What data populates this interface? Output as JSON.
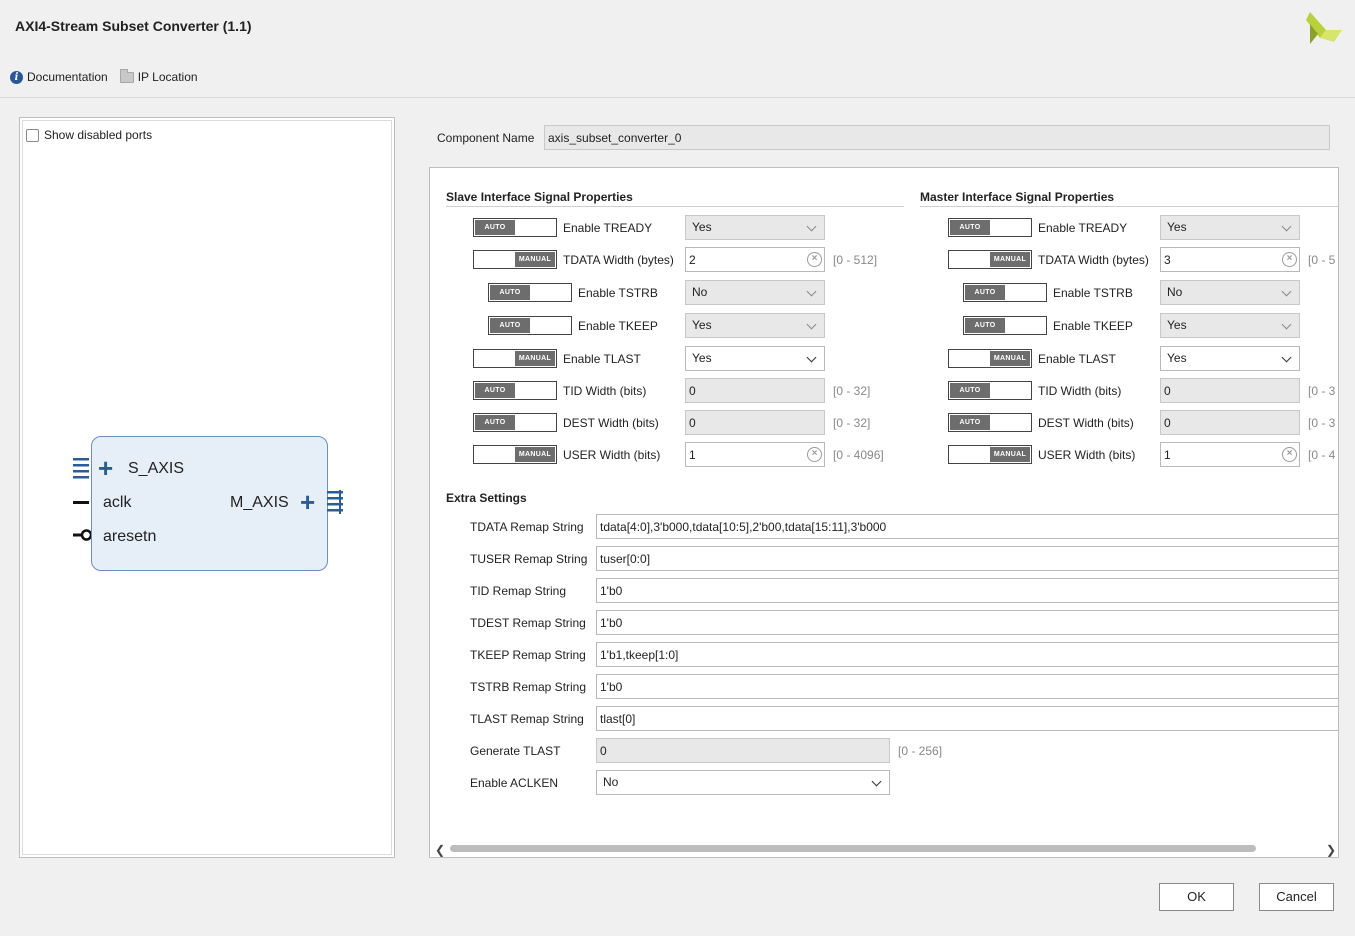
{
  "window": {
    "title": "AXI4-Stream Subset Converter (1.1)"
  },
  "links": {
    "documentation": "Documentation",
    "ip_location": "IP Location"
  },
  "left": {
    "show_disabled": "Show disabled ports",
    "block": {
      "s_axis": "S_AXIS",
      "aclk": "aclk",
      "aresetn": "aresetn",
      "m_axis": "M_AXIS"
    }
  },
  "component": {
    "label": "Component Name",
    "value": "axis_subset_converter_0"
  },
  "slave": {
    "title": "Slave Interface Signal Properties",
    "rows": [
      {
        "mode": "AUTO",
        "label": "Enable TREADY",
        "value": "Yes",
        "range": ""
      },
      {
        "mode": "MANUAL",
        "label": "TDATA Width (bytes)",
        "value": "2",
        "range": "[0 - 512]"
      },
      {
        "mode": "AUTO",
        "label": "Enable TSTRB",
        "value": "No",
        "range": ""
      },
      {
        "mode": "AUTO",
        "label": "Enable TKEEP",
        "value": "Yes",
        "range": ""
      },
      {
        "mode": "MANUAL",
        "label": "Enable TLAST",
        "value": "Yes",
        "range": ""
      },
      {
        "mode": "AUTO",
        "label": "TID Width (bits)",
        "value": "0",
        "range": "[0 - 32]"
      },
      {
        "mode": "AUTO",
        "label": "DEST Width (bits)",
        "value": "0",
        "range": "[0 - 32]"
      },
      {
        "mode": "MANUAL",
        "label": "USER Width (bits)",
        "value": "1",
        "range": "[0 - 4096]"
      }
    ]
  },
  "master": {
    "title": "Master Interface Signal Properties",
    "rows": [
      {
        "mode": "AUTO",
        "label": "Enable TREADY",
        "value": "Yes",
        "range": ""
      },
      {
        "mode": "MANUAL",
        "label": "TDATA Width (bytes)",
        "value": "3",
        "range": "[0 - 5"
      },
      {
        "mode": "AUTO",
        "label": "Enable TSTRB",
        "value": "No",
        "range": ""
      },
      {
        "mode": "AUTO",
        "label": "Enable TKEEP",
        "value": "Yes",
        "range": ""
      },
      {
        "mode": "MANUAL",
        "label": "Enable TLAST",
        "value": "Yes",
        "range": ""
      },
      {
        "mode": "AUTO",
        "label": "TID Width (bits)",
        "value": "0",
        "range": "[0 - 3"
      },
      {
        "mode": "AUTO",
        "label": "DEST Width (bits)",
        "value": "0",
        "range": "[0 - 3"
      },
      {
        "mode": "MANUAL",
        "label": "USER Width (bits)",
        "value": "1",
        "range": "[0 - 4"
      }
    ]
  },
  "extra": {
    "title": "Extra Settings",
    "rows": [
      {
        "label": "TDATA Remap String",
        "value": "tdata[4:0],3'b000,tdata[10:5],2'b00,tdata[15:11],3'b000"
      },
      {
        "label": "TUSER Remap String",
        "value": "tuser[0:0]"
      },
      {
        "label": "TID Remap String",
        "value": "1'b0"
      },
      {
        "label": "TDEST Remap String",
        "value": "1'b0"
      },
      {
        "label": "TKEEP Remap String",
        "value": "1'b1,tkeep[1:0]"
      },
      {
        "label": "TSTRB Remap String",
        "value": "1'b0"
      },
      {
        "label": "TLAST Remap String",
        "value": "tlast[0]"
      }
    ],
    "generate_tlast": {
      "label": "Generate TLAST",
      "value": "0",
      "range": "[0 - 256]"
    },
    "enable_aclken": {
      "label": "Enable ACLKEN",
      "value": "No"
    }
  },
  "buttons": {
    "ok": "OK",
    "cancel": "Cancel"
  },
  "colors": {
    "logo": "#9bb536",
    "port_accent": "#2b5c9a"
  }
}
